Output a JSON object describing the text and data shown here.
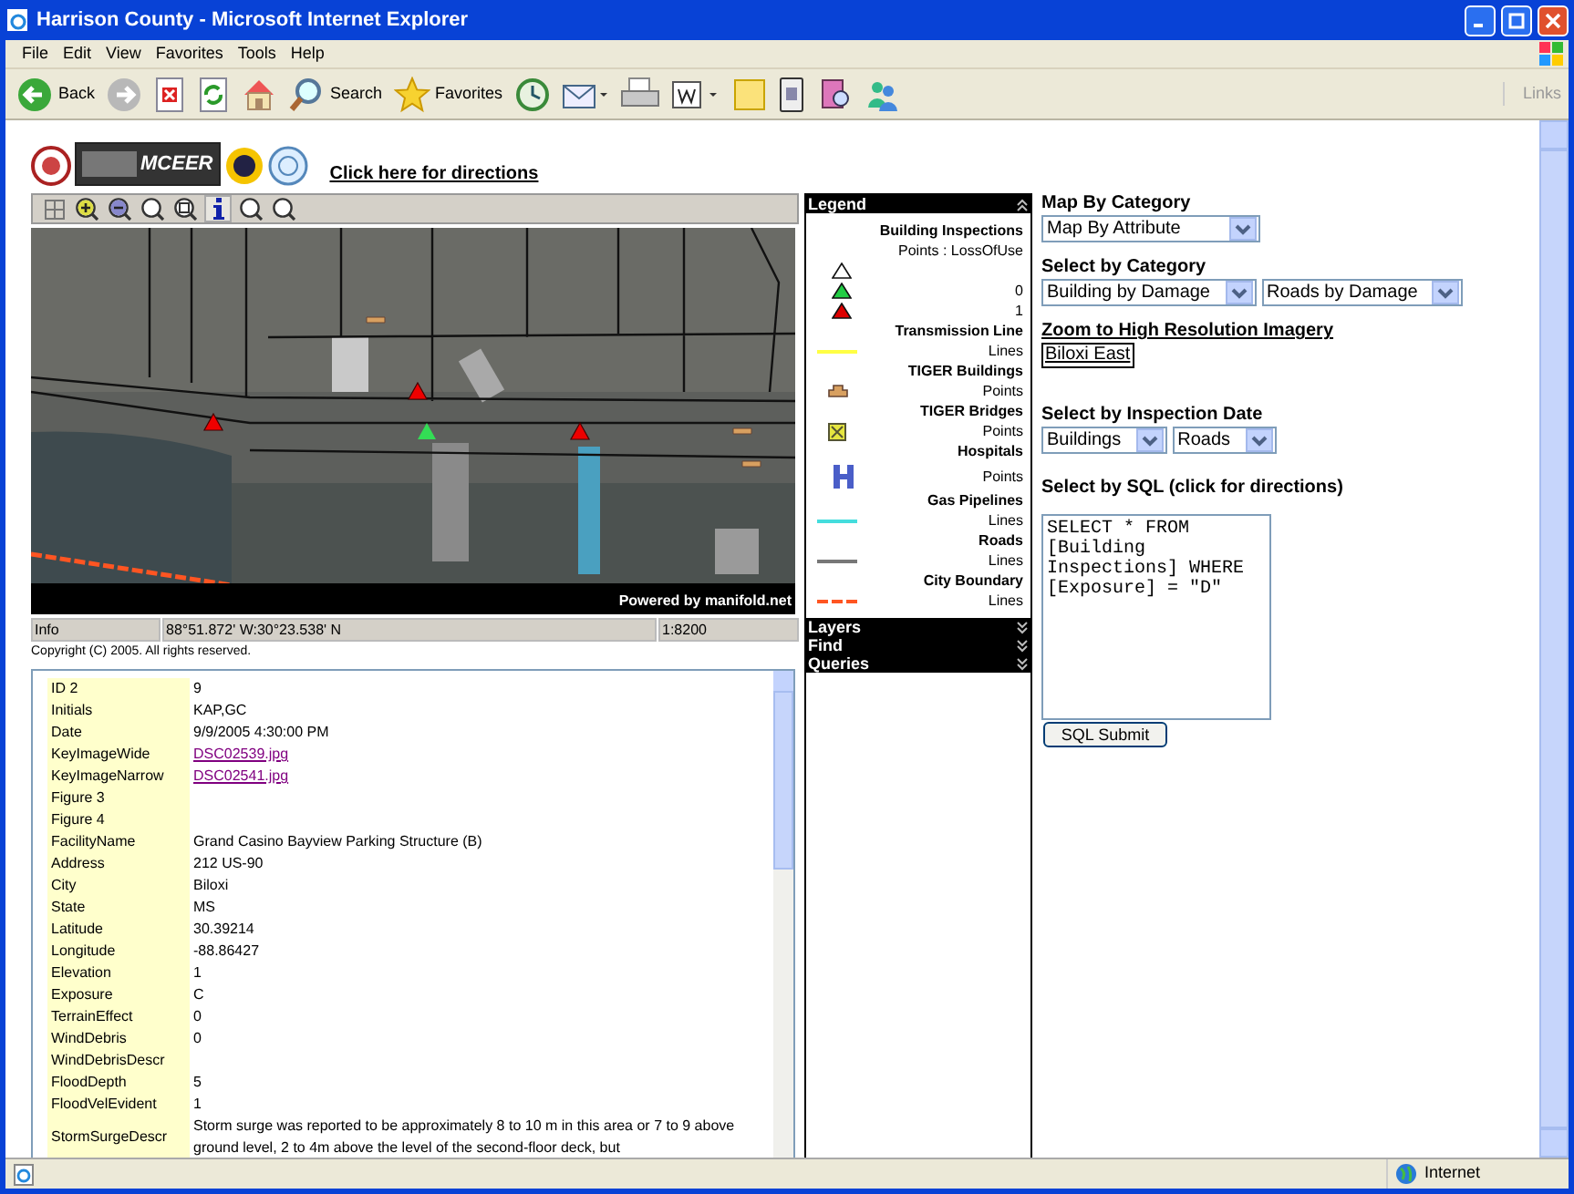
{
  "window": {
    "title": "Harrison County - Microsoft Internet Explorer"
  },
  "menu": [
    "File",
    "Edit",
    "View",
    "Favorites",
    "Tools",
    "Help"
  ],
  "toolbar": [
    {
      "kind": "back",
      "label": "Back"
    },
    {
      "kind": "forward"
    },
    {
      "kind": "stop"
    },
    {
      "kind": "refresh"
    },
    {
      "kind": "home"
    },
    {
      "kind": "search",
      "label": "Search"
    },
    {
      "kind": "favorites",
      "label": "Favorites"
    },
    {
      "kind": "history"
    },
    {
      "kind": "mail"
    },
    {
      "kind": "print"
    },
    {
      "kind": "edit"
    },
    {
      "kind": "note"
    },
    {
      "kind": "device"
    },
    {
      "kind": "research"
    },
    {
      "kind": "messenger"
    }
  ],
  "links_label": "Links",
  "header": {
    "logo_text": "MCEER",
    "directions_link": "Click here for directions"
  },
  "map": {
    "tools": [
      {
        "kind": "extent",
        "selected": false
      },
      {
        "kind": "zoom-in",
        "selected": false
      },
      {
        "kind": "zoom-out",
        "selected": false
      },
      {
        "kind": "zoom",
        "selected": false
      },
      {
        "kind": "zoom-box",
        "selected": false
      },
      {
        "kind": "info",
        "selected": true
      },
      {
        "kind": "zoom",
        "selected": false
      },
      {
        "kind": "zoom",
        "selected": false
      }
    ],
    "credit": "Powered by manifold.net",
    "mode": "Info",
    "coordinates": "88°51.872' W:30°23.538' N",
    "scale": "1:8200"
  },
  "copyright": "Copyright (C) 2005. All rights reserved.",
  "legend": {
    "sections": [
      {
        "title": "Legend",
        "expanded": true
      },
      {
        "title": "Layers",
        "expanded": false
      },
      {
        "title": "Find",
        "expanded": false
      },
      {
        "title": "Queries",
        "expanded": false
      }
    ],
    "layers": [
      {
        "name": "Building Inspections",
        "type": "Points : LossOfUse",
        "kind": "triangles",
        "classes": [
          {
            "color": "#ffffff"
          },
          {
            "color": "#22cc44",
            "label": "0"
          },
          {
            "color": "#dd0000",
            "label": "1"
          }
        ]
      },
      {
        "name": "Transmission Line",
        "type": "Lines",
        "kind": "line",
        "color": "#ffff44"
      },
      {
        "name": "TIGER Buildings",
        "type": "Points",
        "kind": "building"
      },
      {
        "name": "TIGER Bridges",
        "type": "Points",
        "kind": "bridge"
      },
      {
        "name": "Hospitals",
        "type": "Points",
        "kind": "hospital"
      },
      {
        "name": "Gas Pipelines",
        "type": "Lines",
        "kind": "line",
        "color": "#44dddd"
      },
      {
        "name": "Roads",
        "type": "Lines",
        "kind": "line",
        "color": "#777777"
      },
      {
        "name": "City Boundary",
        "type": "Lines",
        "kind": "dashed",
        "color": "#ff5522"
      }
    ]
  },
  "controls": {
    "map_by_category": {
      "label": "Map By Category",
      "value": "Map By Attribute"
    },
    "select_by_category": {
      "label": "Select by Category",
      "values": [
        "Building by Damage",
        "Roads by Damage"
      ]
    },
    "zoom_imagery": {
      "label": "Zoom to High Resolution Imagery",
      "button": "Biloxi East"
    },
    "inspection_date": {
      "label": "Select by Inspection Date",
      "values": [
        "Buildings",
        "Roads"
      ]
    },
    "sql": {
      "label": "Select by SQL (click for directions)",
      "value": "SELECT * FROM [Building Inspections] WHERE [Exposure] = \"D\"",
      "submit": "SQL Submit"
    }
  },
  "info": [
    {
      "label": "ID 2",
      "value": "9"
    },
    {
      "label": "Initials",
      "value": "KAP,GC"
    },
    {
      "label": "Date",
      "value": "9/9/2005 4:30:00 PM"
    },
    {
      "label": "KeyImageWide",
      "value": "DSC02539.jpg",
      "kind": "link"
    },
    {
      "label": "KeyImageNarrow",
      "value": "DSC02541.jpg",
      "kind": "link"
    },
    {
      "label": "Figure 3"
    },
    {
      "label": "Figure 4"
    },
    {
      "label": "FacilityName",
      "value": "Grand Casino Bayview Parking Structure (B)"
    },
    {
      "label": "Address",
      "value": "212 US-90"
    },
    {
      "label": "City",
      "value": "Biloxi"
    },
    {
      "label": "State",
      "value": "MS"
    },
    {
      "label": "Latitude",
      "value": "30.39214"
    },
    {
      "label": "Longitude",
      "value": "-88.86427"
    },
    {
      "label": "Elevation",
      "value": "1"
    },
    {
      "label": "Exposure",
      "value": "C"
    },
    {
      "label": "TerrainEffect",
      "value": "0"
    },
    {
      "label": "WindDebris",
      "value": "0"
    },
    {
      "label": "WindDebrisDescr"
    },
    {
      "label": "FloodDepth",
      "value": "5"
    },
    {
      "label": "FloodVelEvident",
      "value": "1"
    },
    {
      "label": "StormSurgeDescr",
      "value": "Storm surge was reported to be approximately 8 to 10 m in this area or 7 to 9 above ground level, 2 to 4m above the level of the second-floor deck, but"
    }
  ],
  "status_bar": {
    "zone": "Internet"
  }
}
